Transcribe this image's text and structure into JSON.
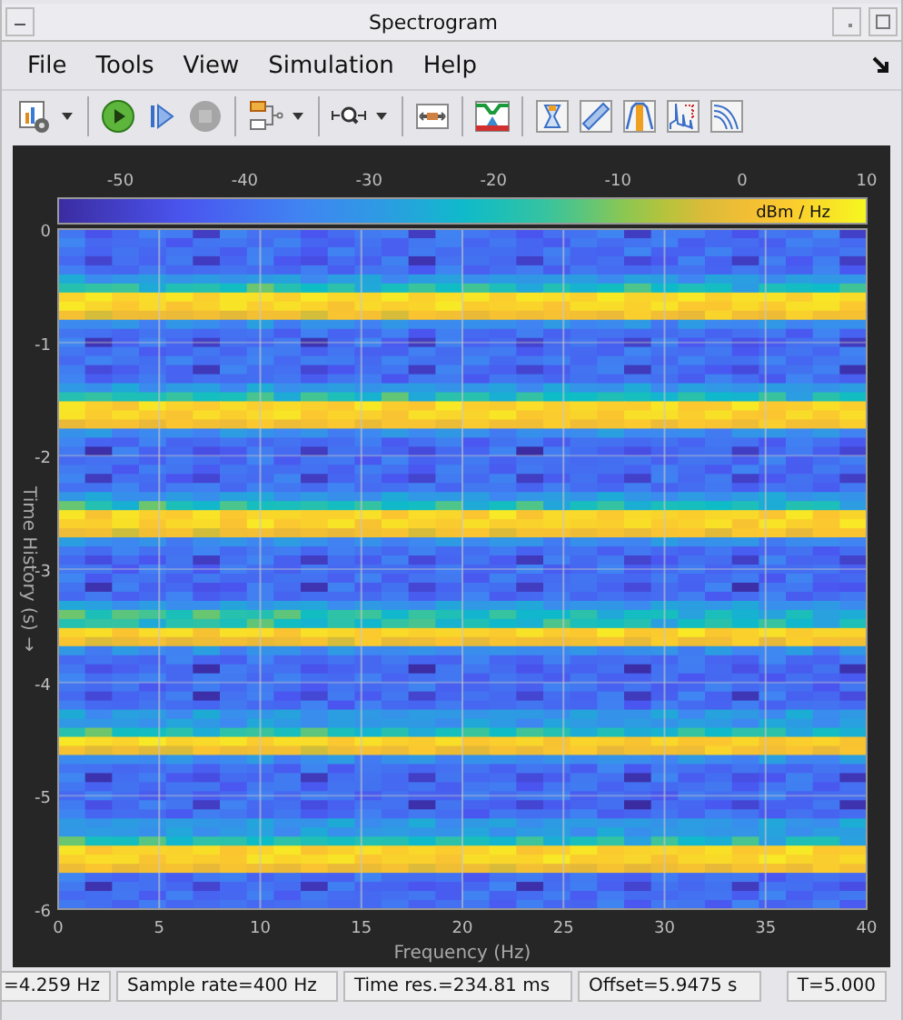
{
  "window": {
    "title": "Spectrogram"
  },
  "menu": [
    {
      "label": "File"
    },
    {
      "label": "Tools"
    },
    {
      "label": "View"
    },
    {
      "label": "Simulation"
    },
    {
      "label": "Help"
    }
  ],
  "toolbar": [
    {
      "kind": "settings",
      "dropdown": true,
      "disabled": false
    },
    {
      "kind": "separator"
    },
    {
      "kind": "run",
      "dropdown": false,
      "disabled": false
    },
    {
      "kind": "step",
      "dropdown": false,
      "disabled": false
    },
    {
      "kind": "stop",
      "dropdown": false,
      "disabled": true
    },
    {
      "kind": "separator"
    },
    {
      "kind": "blocks",
      "dropdown": true,
      "disabled": false
    },
    {
      "kind": "separator"
    },
    {
      "kind": "zoom",
      "dropdown": true,
      "disabled": false
    },
    {
      "kind": "separator"
    },
    {
      "kind": "span",
      "dropdown": false,
      "disabled": false
    },
    {
      "kind": "separator"
    },
    {
      "kind": "mask",
      "dropdown": false,
      "disabled": false
    },
    {
      "kind": "separator"
    },
    {
      "kind": "hourglass",
      "dropdown": false,
      "disabled": false
    },
    {
      "kind": "ruler",
      "dropdown": false,
      "disabled": false
    },
    {
      "kind": "peak",
      "dropdown": false,
      "disabled": false
    },
    {
      "kind": "distortion",
      "dropdown": false,
      "disabled": false
    },
    {
      "kind": "ccdf",
      "dropdown": false,
      "disabled": false
    }
  ],
  "plot": {
    "colorbar": {
      "ticks": [
        "-50",
        "-40",
        "-30",
        "-20",
        "-10",
        "0",
        "10"
      ],
      "label": "dBm / Hz"
    },
    "xticks": [
      "0",
      "5",
      "10",
      "15",
      "20",
      "25",
      "30",
      "35",
      "40"
    ],
    "yticks": [
      "0",
      "-1",
      "-2",
      "-3",
      "-4",
      "-5",
      "-6"
    ],
    "xlabel": "Frequency (Hz)",
    "ylabel": "Time History (s) →"
  },
  "status_bar": [
    "=4.259 Hz",
    "Sample rate=400 Hz",
    "Time res.=234.81 ms",
    "Offset=5.9475 s",
    "T=5.000"
  ]
}
